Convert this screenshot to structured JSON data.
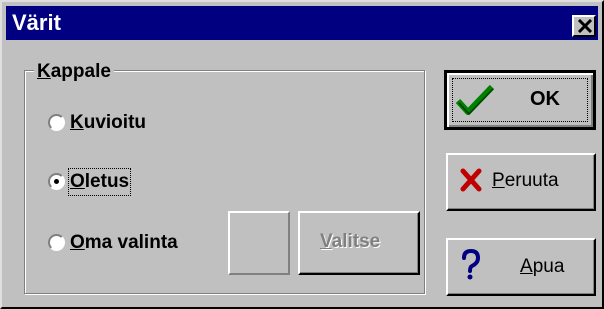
{
  "window": {
    "title": "Värit"
  },
  "title_bar": {
    "close_icon": "close-x-icon"
  },
  "group": {
    "label_first": "K",
    "label_rest": "appale",
    "options": [
      {
        "first": "K",
        "rest": "uvioitu",
        "checked": false
      },
      {
        "first": "O",
        "rest": "letus",
        "checked": true
      },
      {
        "first": "O",
        "rest": "ma valinta",
        "checked": false
      }
    ],
    "choose_button": {
      "first": "V",
      "rest": "alitse",
      "enabled": false
    }
  },
  "buttons": {
    "ok": {
      "label": "OK",
      "icon": "checkmark-icon",
      "icon_color": "#008000"
    },
    "cancel": {
      "first": "P",
      "rest": "eruuta",
      "icon": "red-x-icon",
      "icon_color": "#c00000"
    },
    "help": {
      "first": "A",
      "rest": "pua",
      "icon": "question-mark-icon",
      "icon_color": "#000080"
    }
  },
  "colors": {
    "titlebar": "#000080",
    "face": "#c0c0c0"
  }
}
